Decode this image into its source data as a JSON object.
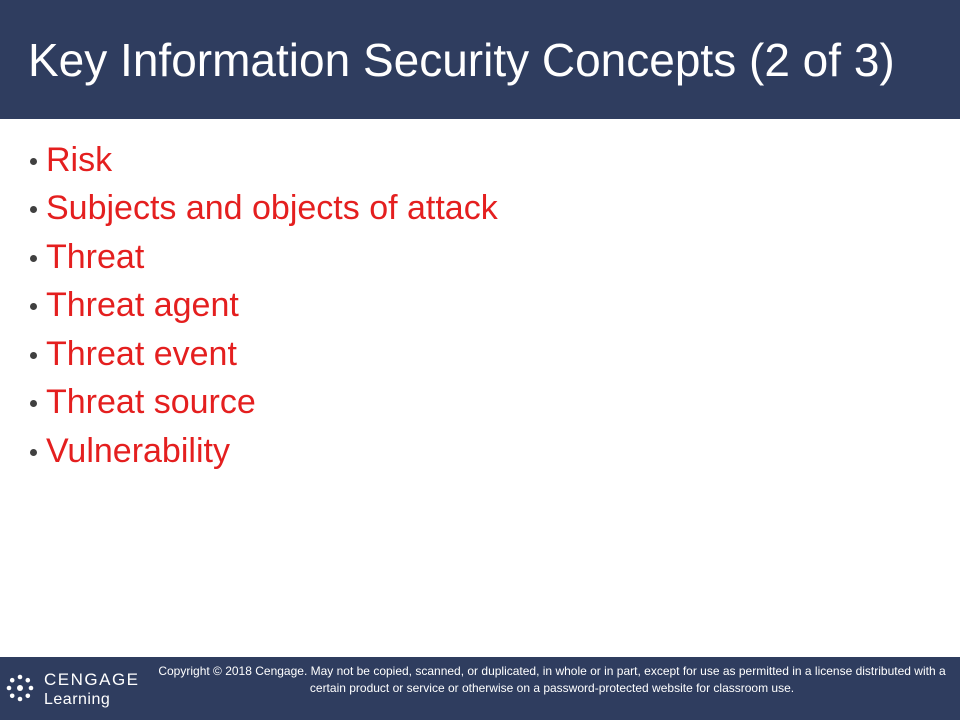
{
  "title": "Key Information Security Concepts (2 of 3)",
  "bullets": [
    "Risk",
    "Subjects and objects of attack",
    "Threat",
    "Threat agent",
    "Threat event",
    "Threat source",
    "Vulnerability"
  ],
  "footer": {
    "logo_line1": "CENGAGE",
    "logo_line2": "Learning",
    "copyright": "Copyright © 2018 Cengage. May not be copied, scanned, or duplicated, in whole or in part, except for use as permitted in a license distributed with a certain product or service or otherwise on a password-protected website for classroom use."
  },
  "colors": {
    "bar_background": "#2f3d5f",
    "title_text": "#ffffff",
    "bullet_text": "#e41f1f",
    "bullet_dot": "#404040",
    "slide_background": "#ffffff"
  },
  "icons": {
    "logo_mark": "cengage-logo-icon"
  }
}
